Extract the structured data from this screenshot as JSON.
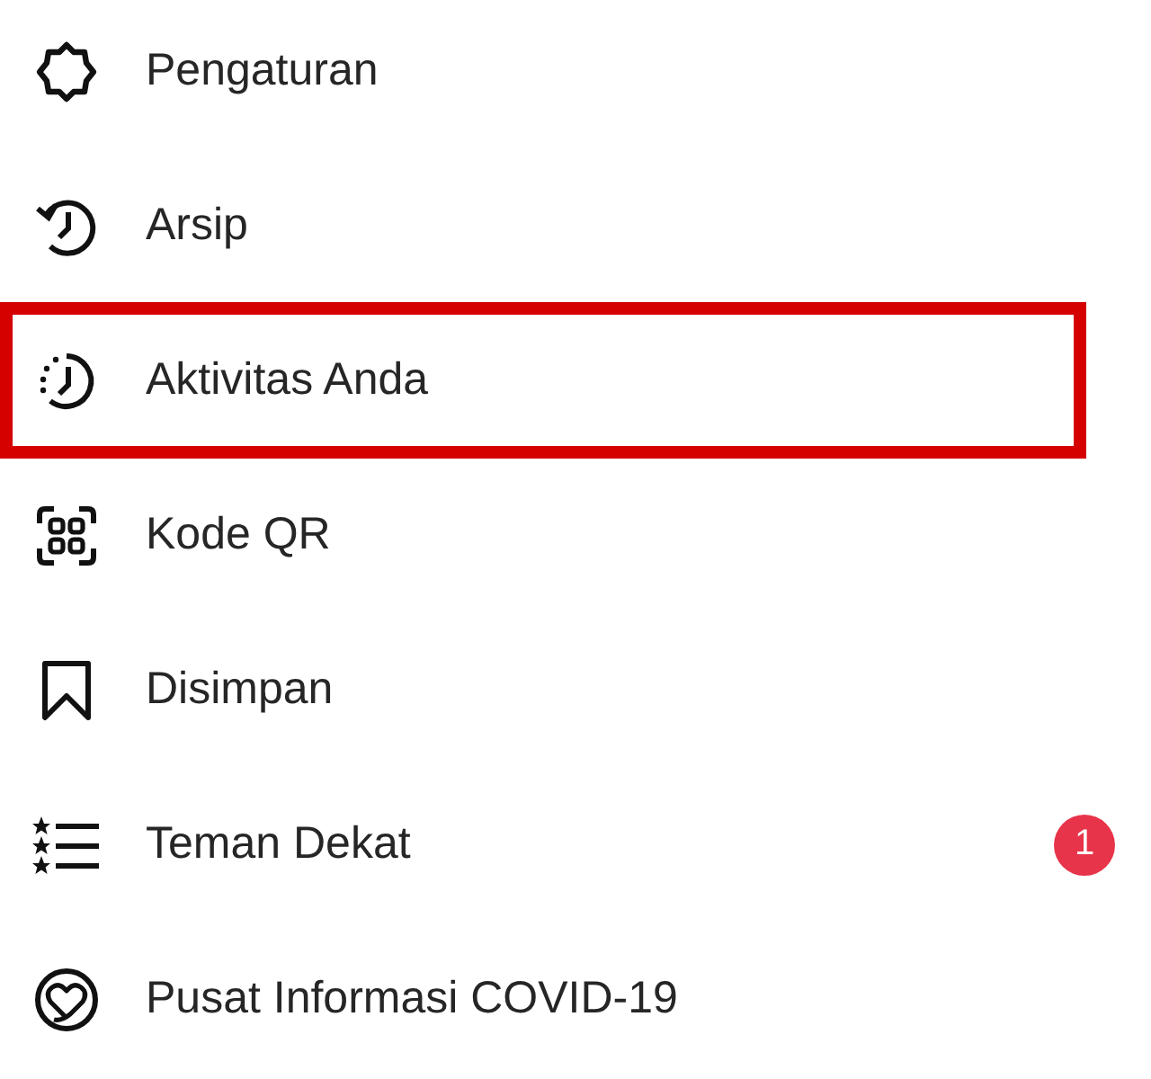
{
  "menu": [
    {
      "kind": "gear",
      "label": "Pengaturan",
      "highlighted": false
    },
    {
      "kind": "history",
      "label": "Arsip",
      "highlighted": false
    },
    {
      "kind": "activity",
      "label": "Aktivitas Anda",
      "highlighted": true
    },
    {
      "kind": "qr",
      "label": "Kode QR",
      "highlighted": false
    },
    {
      "kind": "bookmark",
      "label": "Disimpan",
      "highlighted": false
    },
    {
      "kind": "starlist",
      "label": "Teman Dekat",
      "highlighted": false,
      "badge": "1"
    },
    {
      "kind": "heart",
      "label": "Pusat Informasi COVID-19",
      "highlighted": false
    }
  ]
}
